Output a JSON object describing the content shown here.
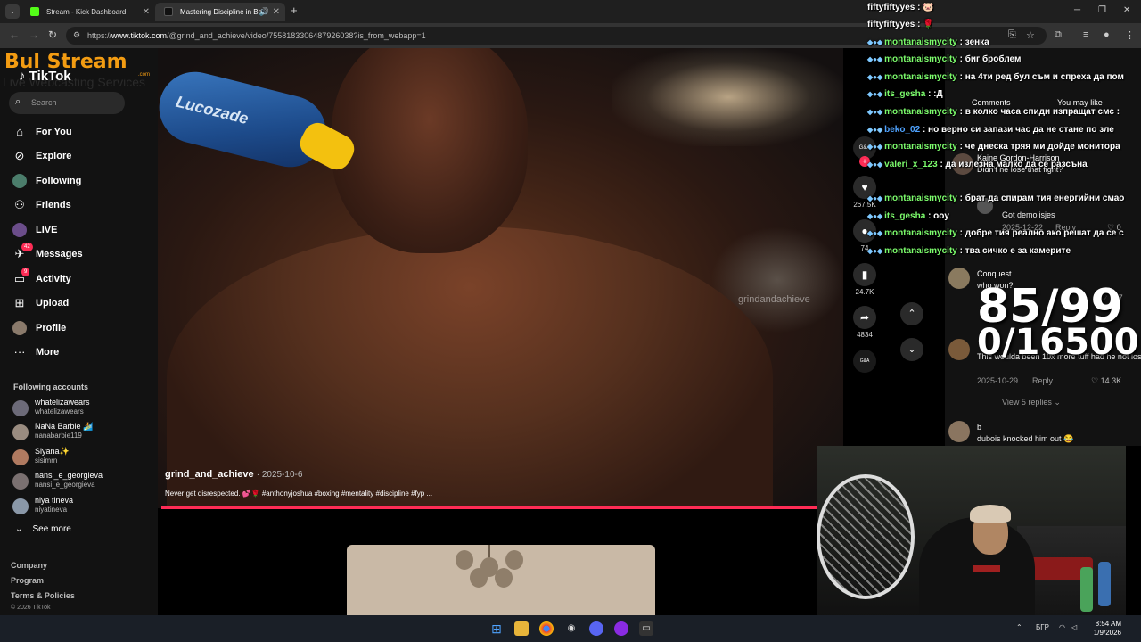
{
  "browser": {
    "tabs": [
      {
        "title": "Stream - Kick Dashboard",
        "active": false
      },
      {
        "title": "Mastering Discipline in Bo",
        "active": true
      }
    ],
    "url_prefix": "https://",
    "url_host": "www.tiktok.com",
    "url_path": "/@grind_and_achieve/video/7558183306487926038?is_from_webapp=1"
  },
  "overlay_logo": {
    "bul": "Bul Stream",
    "com": ".com",
    "subtitle": "Live Webcasting Services"
  },
  "tiktok": {
    "logo": "TikTok",
    "search_placeholder": "Search",
    "nav": [
      {
        "label": "For You",
        "icon": "home-icon"
      },
      {
        "label": "Explore",
        "icon": "compass-icon"
      },
      {
        "label": "Following",
        "icon": "following-icon"
      },
      {
        "label": "Friends",
        "icon": "friends-icon"
      },
      {
        "label": "LIVE",
        "icon": "live-icon"
      },
      {
        "label": "Messages",
        "icon": "messages-icon",
        "badge": "42"
      },
      {
        "label": "Activity",
        "icon": "activity-icon",
        "badge": "9"
      },
      {
        "label": "Upload",
        "icon": "upload-icon"
      },
      {
        "label": "Profile",
        "icon": "profile-icon"
      },
      {
        "label": "More",
        "icon": "more-icon"
      }
    ],
    "following_title": "Following accounts",
    "following": [
      {
        "name": "whatelizawears",
        "handle": "whatelizawears"
      },
      {
        "name": "NaNa Barbie 🏄",
        "handle": "nanabarbie119"
      },
      {
        "name": "Siyana✨",
        "handle": "sisimrn"
      },
      {
        "name": "nansi_e_georgieva",
        "handle": "nansi_e_georgieva"
      },
      {
        "name": "niya tineva",
        "handle": "niyatineva"
      }
    ],
    "see_more": "See more",
    "footer": [
      "Company",
      "Program",
      "Terms & Policies"
    ],
    "copyright": "© 2026 TikTok"
  },
  "video": {
    "watermark": "grindandachieve",
    "author": "grind_and_achieve",
    "date": "· 2025-10-6",
    "description": "Never get disrespected. 💕🌹 #anthonyjoshua #boxing #mentality #discipline #fyp ...",
    "bottle_brand": "Lucozade",
    "progress_fraction": 1.0
  },
  "actions": {
    "likes": "267.5K",
    "comments": "74",
    "saves": "24.7K",
    "shares": "4834"
  },
  "comments_panel": {
    "tabs": [
      "Comments",
      "You may like"
    ],
    "items": [
      {
        "name": "Kaine Gordon-Harrison",
        "text": "Didn't he lose that fight?"
      },
      {
        "name": "",
        "text": "Got demolisjes",
        "date": "2025-12-22",
        "reply": "Reply",
        "likes": "0"
      },
      {
        "name": "Conquest",
        "text": "who won?",
        "likes": "107"
      },
      {
        "name": "",
        "text": "This woulda been 10x more tuff had he not lost this fight",
        "date": "2025-10-29",
        "reply": "Reply",
        "likes": "14.3K"
      },
      {
        "name": "b",
        "text": "dubois knocked him out 😂"
      }
    ],
    "view_replies": "View 5 replies"
  },
  "chat": [
    {
      "user": "fiftyfiftyyes",
      "msg": ": 🐷",
      "color": "white"
    },
    {
      "user": "fiftyfiftyyes",
      "msg": ": 🌹",
      "color": "white"
    },
    {
      "user": "montanaismycity",
      "msg": ": зенка",
      "color": "green"
    },
    {
      "user": "montanaismycity",
      "msg": ": биг броблем",
      "color": "green"
    },
    {
      "user": "montanaismycity",
      "msg": ": на 4ти ред бул съм и спреха да пом",
      "color": "green"
    },
    {
      "user": "its_gesha",
      "msg": ": :Д",
      "color": "green"
    },
    {
      "user": "montanaismycity",
      "msg": ": в колко часа спиди изпращат смс :",
      "color": "green"
    },
    {
      "user": "beko_02",
      "msg": ": но верно си запази час да не стане по зле",
      "color": "blue"
    },
    {
      "user": "montanaismycity",
      "msg": ": че днеска тряя ми дойде монитора",
      "color": "green"
    },
    {
      "user": "valeri_x_123",
      "msg": ": да излезна малко да се разсъна",
      "color": "green"
    },
    {
      "user": "montanaismycity",
      "msg": ": брат да спирам тия енергийни смао",
      "color": "green"
    },
    {
      "user": "its_gesha",
      "msg": ": оoy",
      "color": "green"
    },
    {
      "user": "montanaismycity",
      "msg": ": добре тия реално ако решат да се с",
      "color": "green"
    },
    {
      "user": "montanaismycity",
      "msg": ": тва сичко е за камерите",
      "color": "green"
    }
  ],
  "counters": {
    "line1": "85/99",
    "line2": "0/16500"
  },
  "taskbar": {
    "lang": "БГР",
    "time": "8:54 AM",
    "date": "1/9/2026"
  },
  "colors": {
    "accent": "#fe2c55",
    "chat_green": "#7cfc6c",
    "chat_blue": "#4fa3ff",
    "logo_orange": "#f39c12"
  }
}
